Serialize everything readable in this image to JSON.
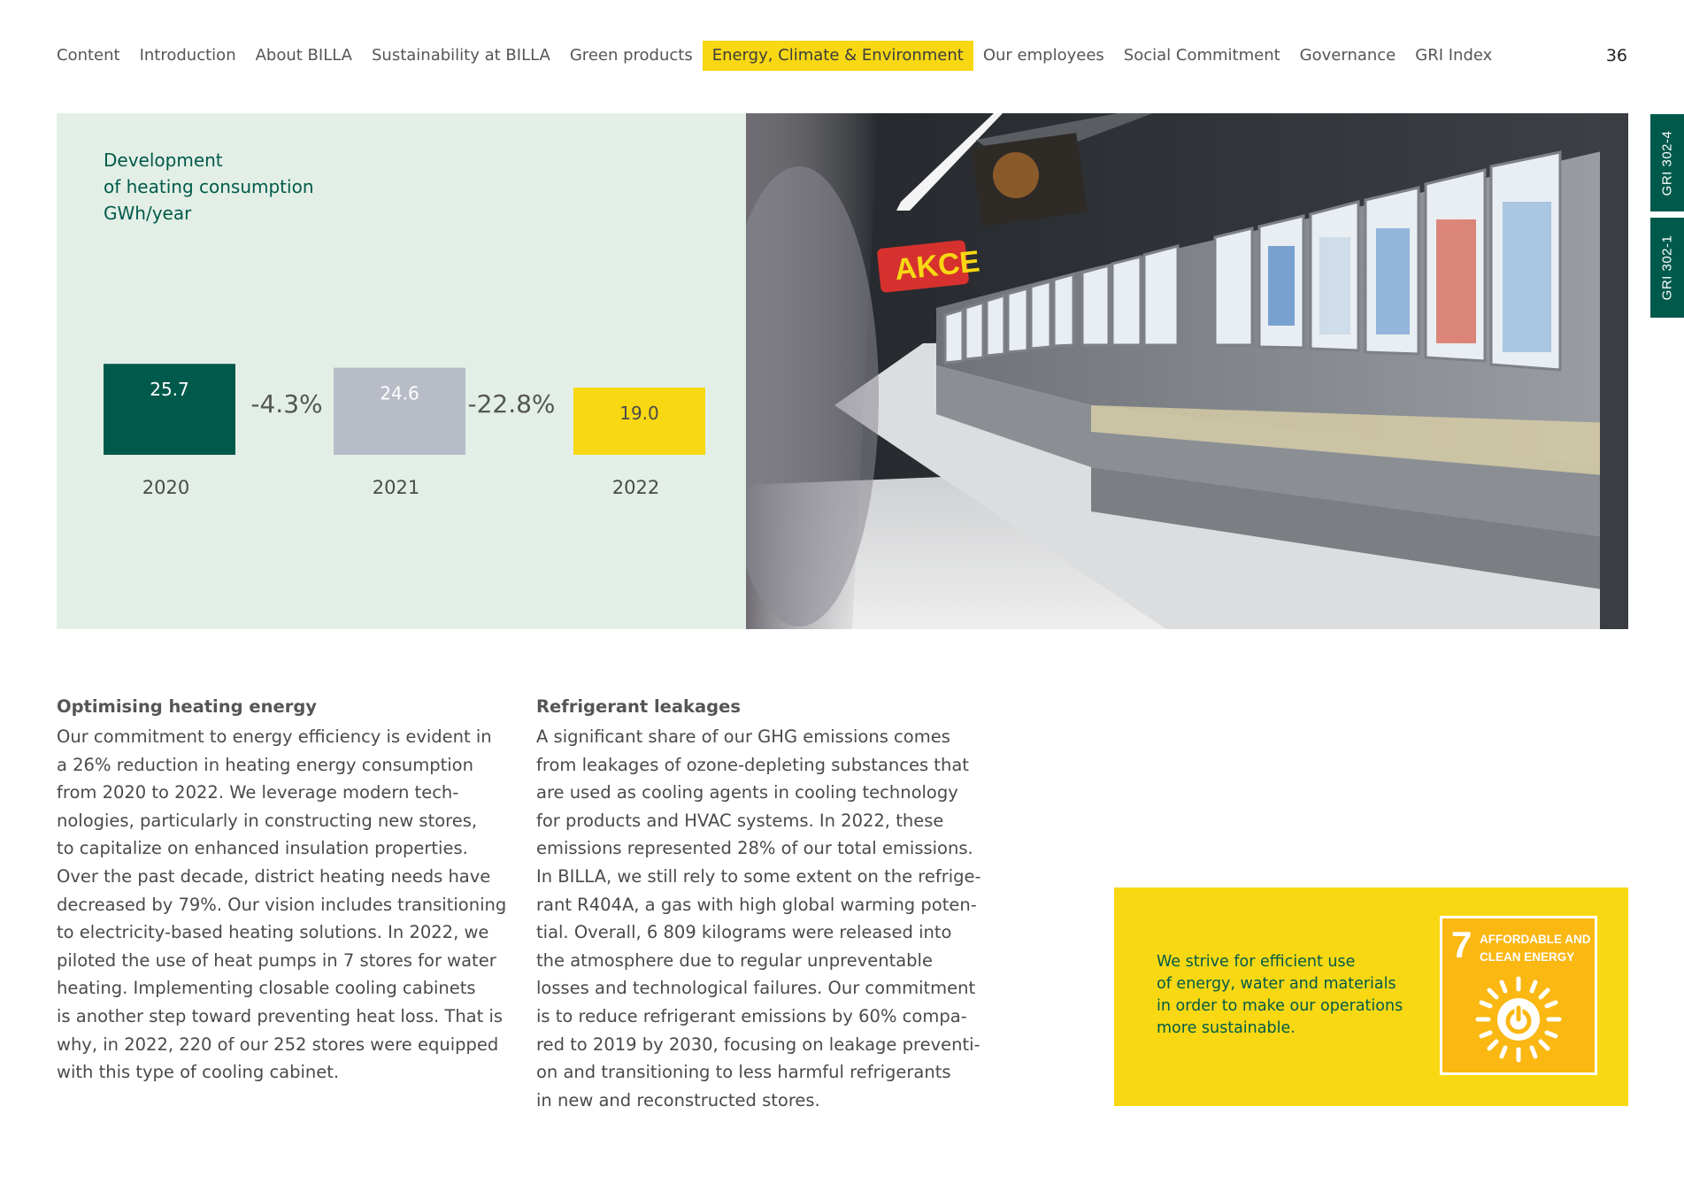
{
  "nav": {
    "items": [
      "Content",
      "Introduction",
      "About BILLA",
      "Sustainability at BILLA",
      "Green products",
      "Energy, Climate & Environment",
      "Our employees",
      "Social Commitment",
      "Governance",
      "GRI Index"
    ],
    "active_index": 5
  },
  "page_number": "36",
  "gri_tabs": [
    "GRI 302-4",
    "GRI 302-1"
  ],
  "colors": {
    "accent_green": "#005a4b",
    "accent_yellow": "#f7d812",
    "panel_bg": "#e3efe6",
    "bar_2021": "#b8bcc7"
  },
  "chart_data": {
    "type": "bar",
    "title_lines": [
      "Development",
      "of heating consumption",
      "GWh/year"
    ],
    "categories": [
      "2020",
      "2021",
      "2022"
    ],
    "values": [
      25.7,
      24.6,
      19.0
    ],
    "value_labels": [
      "25.7",
      "24.6",
      "19.0"
    ],
    "bar_colors": [
      "#005a4b",
      "#b8bcc7",
      "#f7d812"
    ],
    "label_colors": [
      "#ffffff",
      "#ffffff",
      "#4a4a4a"
    ],
    "changes": [
      "-4.3%",
      "-22.8%"
    ]
  },
  "sections": [
    {
      "heading": "Optimising heating energy",
      "lines": [
        "Our commitment to energy efficiency is evident in",
        "a 26% reduction in heating energy consumption",
        "from 2020 to 2022. We leverage modern tech-",
        "nologies, particularly in constructing new stores,",
        "to capitalize on enhanced insulation properties.",
        "Over the past decade, district heating needs have",
        "decreased by 79%. Our vision includes transitioning",
        "to electricity-based heating solutions. In 2022, we",
        "piloted the use of heat pumps in 7 stores for water",
        "heating. Implementing closable cooling cabinets",
        "is another step toward preventing heat loss. That is",
        "why, in 2022, 220 of our 252 stores were equipped",
        "with this type of cooling cabinet."
      ]
    },
    {
      "heading": "Refrigerant leakages",
      "lines": [
        "A significant share of our GHG emissions comes",
        "from leakages of ozone-depleting substances that",
        "are used as cooling agents in cooling technology",
        "for products and HVAC systems. In 2022, these",
        "emissions represented 28% of our total emissions.",
        "In BILLA, we still rely to some extent on the refrige-",
        "rant R404A, a gas with high global warming poten-",
        "tial. Overall, 6 809 kilograms were released into",
        "the atmosphere due to regular unpreventable",
        "losses and technological failures. Our commitment",
        "is to reduce refrigerant emissions by 60% compa-",
        "red to 2019 by 2030, focusing on leakage preventi-",
        "on and transitioning to less harmful refrigerants",
        "in new and reconstructed stores."
      ]
    }
  ],
  "sdg": {
    "text_lines": [
      "We strive for efficient use",
      "of energy, water and materials",
      "in order to make our operations",
      "more sustainable."
    ],
    "number": "7",
    "label_lines": [
      "AFFORDABLE AND",
      "CLEAN ENERGY"
    ],
    "icon": "sun-power-icon"
  },
  "photo": {
    "sign_text": "AKCE"
  }
}
